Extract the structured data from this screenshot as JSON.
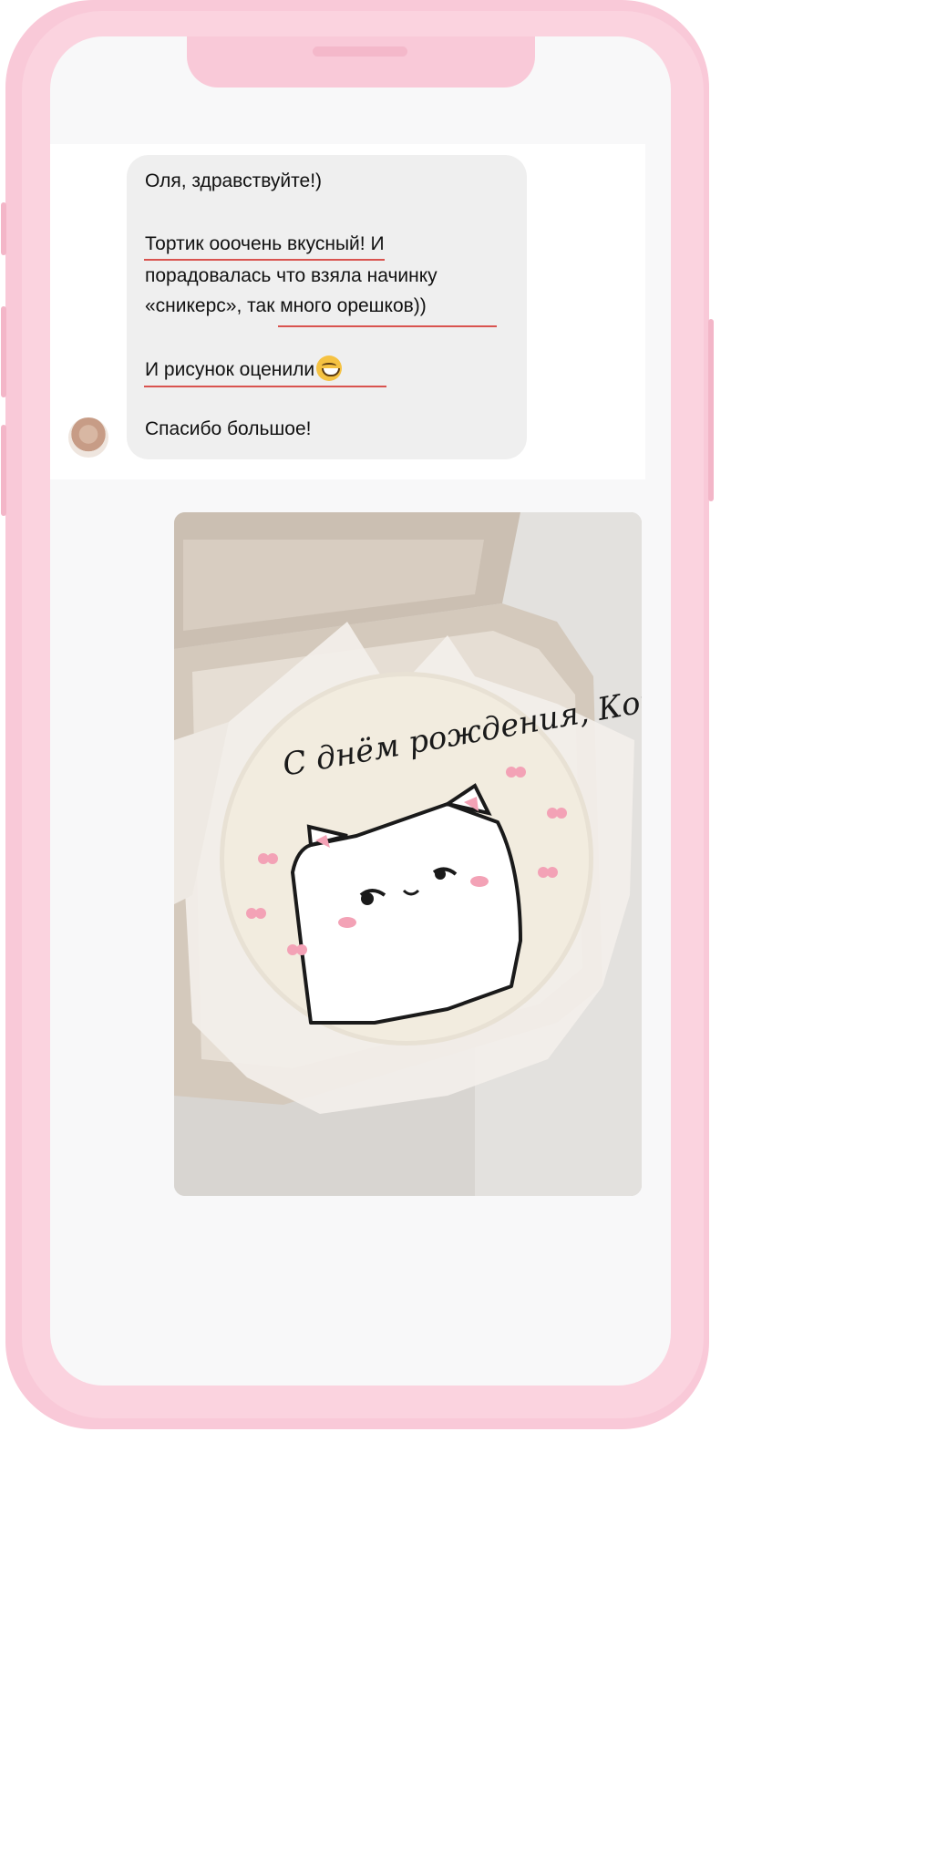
{
  "chat": {
    "greeting": "Оля, здравствуйте!)",
    "line_1": "Тортик ооочень вкусный! И",
    "line_2": "порадовалась что взяла начинку",
    "line_3": "«сникерс», так много орешков))",
    "line_4": "И рисунок оценили",
    "emoji": "grinning-face-emoji",
    "thanks": "Спасибо большое!"
  },
  "photo": {
    "cake_inscription": "С днём рождения, Котя!"
  },
  "colors": {
    "frame": "#f9c9d8",
    "bubble": "#efefef",
    "underline": "#d9534f"
  }
}
